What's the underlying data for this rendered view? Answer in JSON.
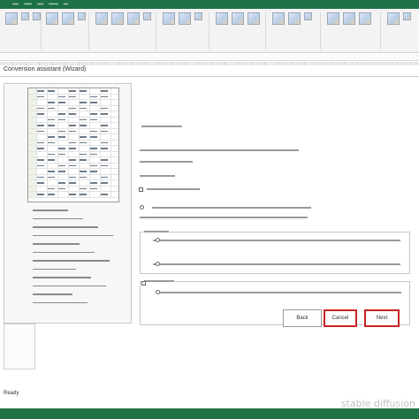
{
  "dialog": {
    "title": "Conversion assistant (Wizard)"
  },
  "buttons": {
    "back": "Back",
    "cancel": "Cancel",
    "next": "Next"
  },
  "status": {
    "text": "Ready"
  },
  "watermark": {
    "text": "stable diffusion"
  },
  "icons": [
    "spreadsheet-icon",
    "chart-icon",
    "table-icon"
  ],
  "colors": {
    "ribbon": "#1e7145",
    "status": "#217346",
    "focus_border": "#c82525"
  }
}
